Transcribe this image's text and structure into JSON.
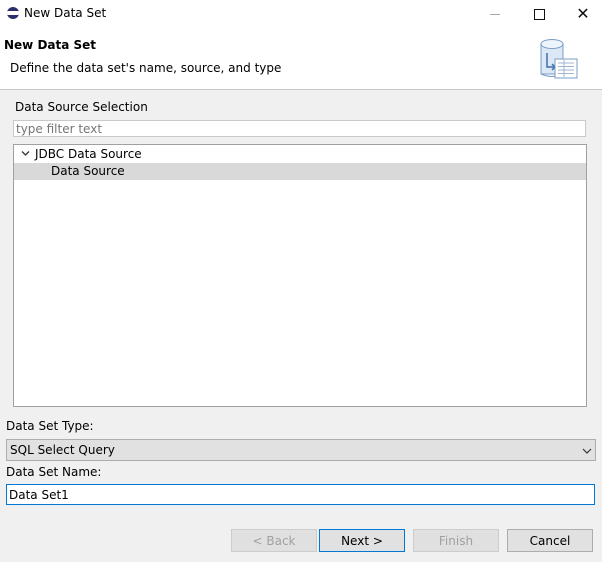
{
  "window": {
    "title": "New Data Set",
    "icon": "eclipse-icon"
  },
  "header": {
    "title": "New Data Set",
    "description": "Define the data set's name, source, and type",
    "image": "database-wizard-icon"
  },
  "data_source_group": {
    "label": "Data Source Selection",
    "filter_placeholder": "type filter text",
    "tree": [
      {
        "label": "JDBC Data Source",
        "expanded": true,
        "selected": false
      },
      {
        "label": "Data Source",
        "selected": true
      }
    ]
  },
  "data_set_type": {
    "label": "Data Set Type:",
    "value": "SQL Select Query"
  },
  "data_set_name": {
    "label": "Data Set Name:",
    "value": "Data Set1"
  },
  "buttons": {
    "back": "< Back",
    "next": "Next >",
    "finish": "Finish",
    "cancel": "Cancel"
  },
  "colors": {
    "focus_accent": "#0078d7",
    "tree_selection": "#d9d9d9",
    "dialog_background": "#f0f0f0"
  }
}
